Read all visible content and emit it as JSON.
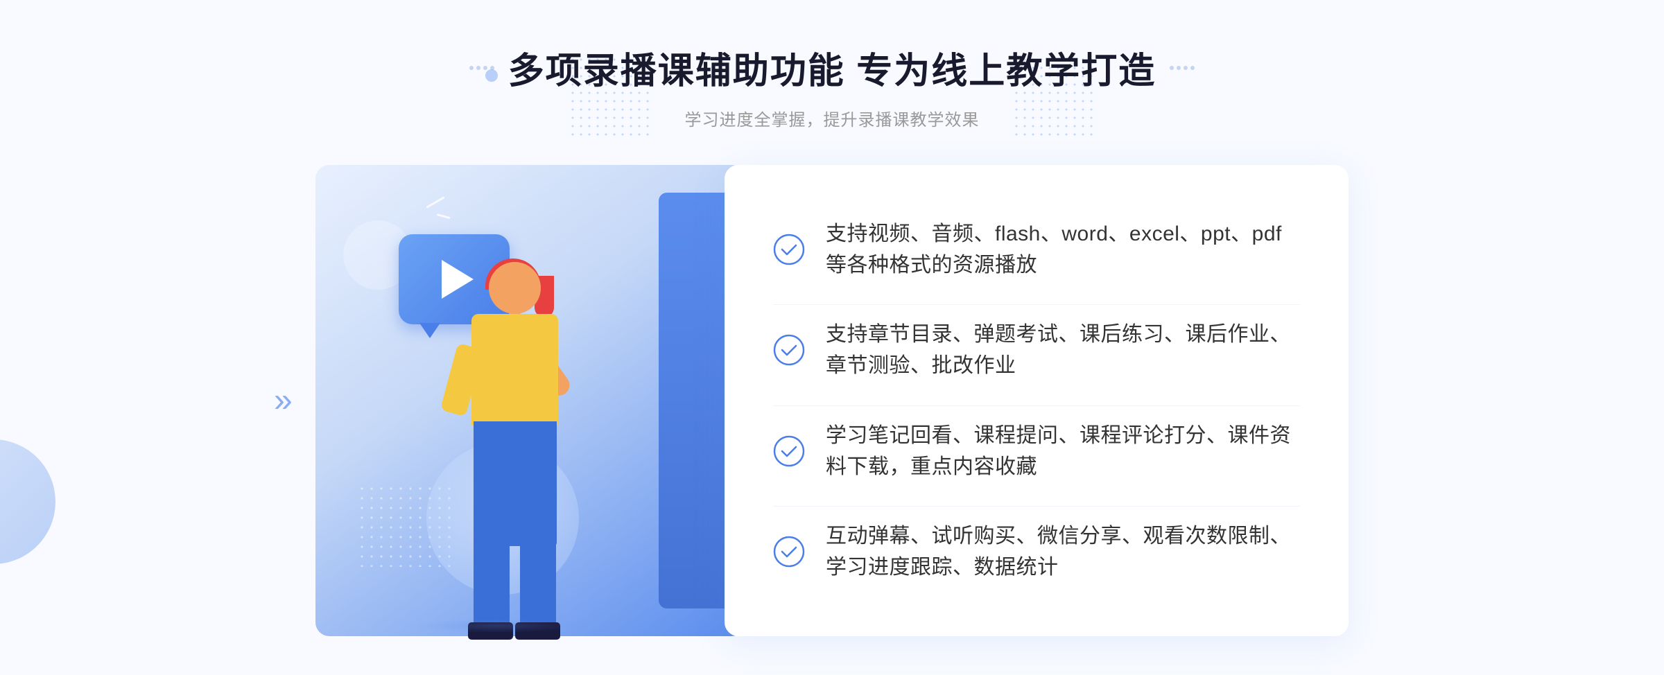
{
  "header": {
    "title": "多项录播课辅助功能 专为线上教学打造",
    "subtitle": "学习进度全掌握，提升录播课教学效果"
  },
  "features": [
    {
      "id": "feature-1",
      "text": "支持视频、音频、flash、word、excel、ppt、pdf等各种格式的资源播放"
    },
    {
      "id": "feature-2",
      "text": "支持章节目录、弹题考试、课后练习、课后作业、章节测验、批改作业"
    },
    {
      "id": "feature-3",
      "text": "学习笔记回看、课程提问、课程评论打分、课件资料下载，重点内容收藏"
    },
    {
      "id": "feature-4",
      "text": "互动弹幕、试听购买、微信分享、观看次数限制、学习进度跟踪、数据统计"
    }
  ],
  "decorators": {
    "left_chevron": "»",
    "check_color": "#4a7ee8"
  }
}
